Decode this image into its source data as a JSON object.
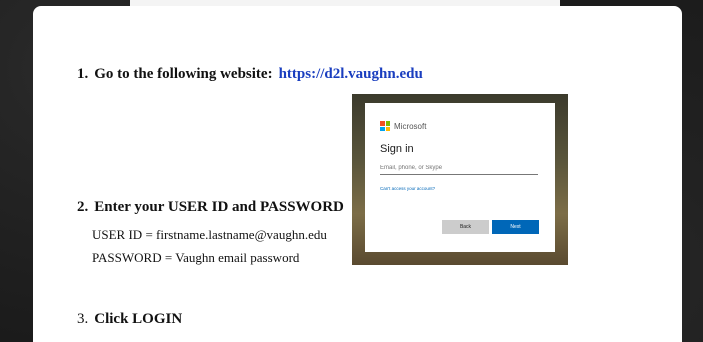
{
  "steps": {
    "step1": {
      "number": "1.",
      "text": "Go to the following website:",
      "link": "https://d2l.vaughn.edu"
    },
    "step2": {
      "number": "2.",
      "text": "Enter your USER ID and PASSWORD",
      "user_id_line": "USER ID = firstname.lastname@vaughn.edu",
      "password_line": "PASSWORD = Vaughn email password"
    },
    "step3": {
      "number": "3.",
      "text": "Click LOGIN"
    }
  },
  "signin_dialog": {
    "brand": "Microsoft",
    "title": "Sign in",
    "email_placeholder": "Email, phone, or Skype",
    "cant_access": "Can't access your account?",
    "back_label": "Back",
    "next_label": "Next"
  },
  "colors": {
    "link": "#1a3ebf",
    "next_button": "#0067b8",
    "ms_red": "#f25022",
    "ms_green": "#7fba00",
    "ms_blue": "#00a4ef",
    "ms_yellow": "#ffb900",
    "accent": "#d33a7a"
  }
}
